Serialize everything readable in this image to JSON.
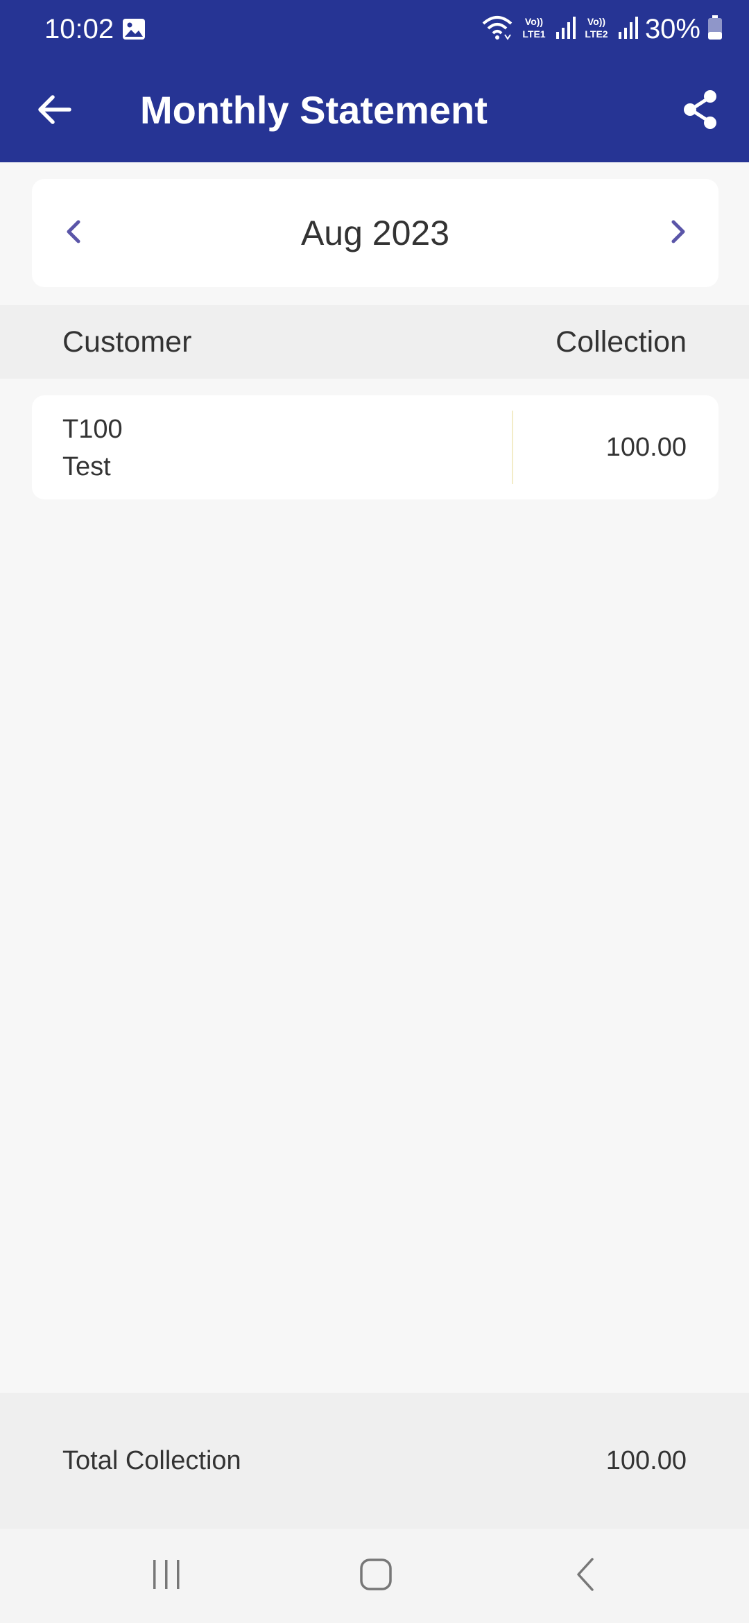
{
  "status_bar": {
    "time": "10:02",
    "battery": "30%",
    "icons": [
      "gallery-icon",
      "wifi-icon",
      "volte-lte1-icon",
      "signal-icon",
      "volte-lte2-icon",
      "signal-icon",
      "battery-icon"
    ]
  },
  "toolbar": {
    "title": "Monthly Statement",
    "back_icon": "arrow-left-icon",
    "share_icon": "share-icon"
  },
  "month_selector": {
    "label": "Aug 2023",
    "prev_icon": "chevron-left-icon",
    "next_icon": "chevron-right-icon"
  },
  "table": {
    "headers": {
      "customer": "Customer",
      "collection": "Collection"
    },
    "rows": [
      {
        "code": "T100",
        "name": "Test",
        "collection": "100.00"
      }
    ]
  },
  "total": {
    "label": "Total Collection",
    "value": "100.00"
  },
  "colors": {
    "primary": "#263494",
    "accent": "#5a55a8",
    "background": "#f7f7f7",
    "card": "#ffffff"
  }
}
